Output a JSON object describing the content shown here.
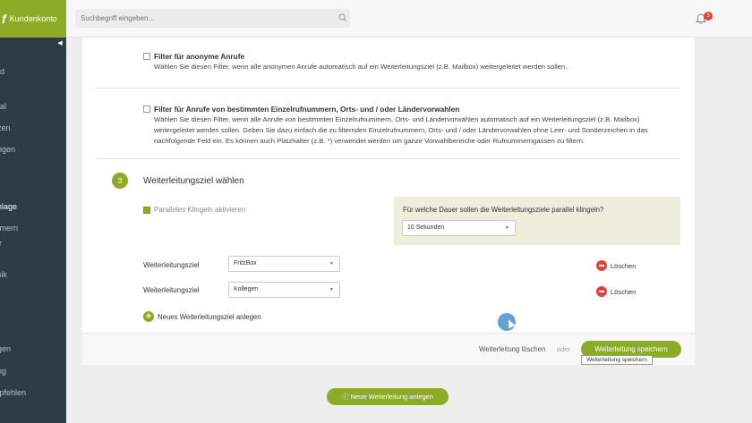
{
  "app": {
    "brand_mark": "f",
    "brand_text": "Kundenkonto",
    "accent_color": "#8dab27",
    "sidebar_color": "#2e3c48"
  },
  "search": {
    "placeholder": "Suchbegriff eingeben..."
  },
  "notifications": {
    "count": "3"
  },
  "sidebar": {
    "items": [
      {
        "label": "ard"
      },
      {
        "label": "rnal"
      },
      {
        "label": "nzen"
      },
      {
        "label": "ungen"
      },
      {
        "label": "e"
      },
      {
        "label": "anlage"
      },
      {
        "label": "mmern"
      },
      {
        "label": "ler"
      },
      {
        "label": "usik"
      },
      {
        "label": ""
      },
      {
        "label": "e"
      },
      {
        "label": "ngen"
      },
      {
        "label": "ung"
      },
      {
        "label": "mpfehlen"
      }
    ]
  },
  "filters": [
    {
      "title": "Filter für anonyme Anrufe",
      "desc": "Wählen Sie diesen Filter, wenn alle anonymen Anrufe automatisch auf ein Weiterleitungsziel (z.B. Mailbox) weitergeleitet werden sollen."
    },
    {
      "title": "Filter für Anrufe von bestimmten Einzelrufnummern, Orts- und / oder Ländervorwahlen",
      "desc": "Wählen Sie diesen Filter, wenn alle Anrufe von bestimmten Einzelrufnummern, Orts- und Ländervorwahlen automatisch auf ein Weiterleitungsziel (z.B. Mailbox) weitergeleitet werden sollen. Geben Sie dazu einfach die zu filternden Einzelrufnummern, Orts- und / oder Ländervorwahlen ohne Leer- und Sonderzeichen in das nachfolgende Feld ein. Es können auch Platzhalter (z.B. *) verwendet werden um ganze Vorwahlbereiche oder Rufnummerngassen zu filtern."
    }
  ],
  "step": {
    "number": "3",
    "title": "Weiterleitungsziel wählen",
    "parallel_label": "Paralleles Klingeln aktivieren",
    "dauer_question": "Für welche Dauer sollen die Weiterleitungsziele parallel klingeln?",
    "dauer_value": "10 Sekunden"
  },
  "targets": [
    {
      "label": "Weiterleitungsziel",
      "value": "FritzBox",
      "delete": "Löschen"
    },
    {
      "label": "Weiterleitungsziel",
      "value": "Kollegen",
      "delete": "Löschen"
    }
  ],
  "add_target": "Neues Weiterleitungsziel anlegen",
  "footer": {
    "delete_forward": "Weiterleitung löschen",
    "or": "oder",
    "save": "Weiterleitung speichern",
    "tooltip": "Weiterleitung speichern"
  },
  "new_forward": "Neue Weiterleitung anlegen"
}
